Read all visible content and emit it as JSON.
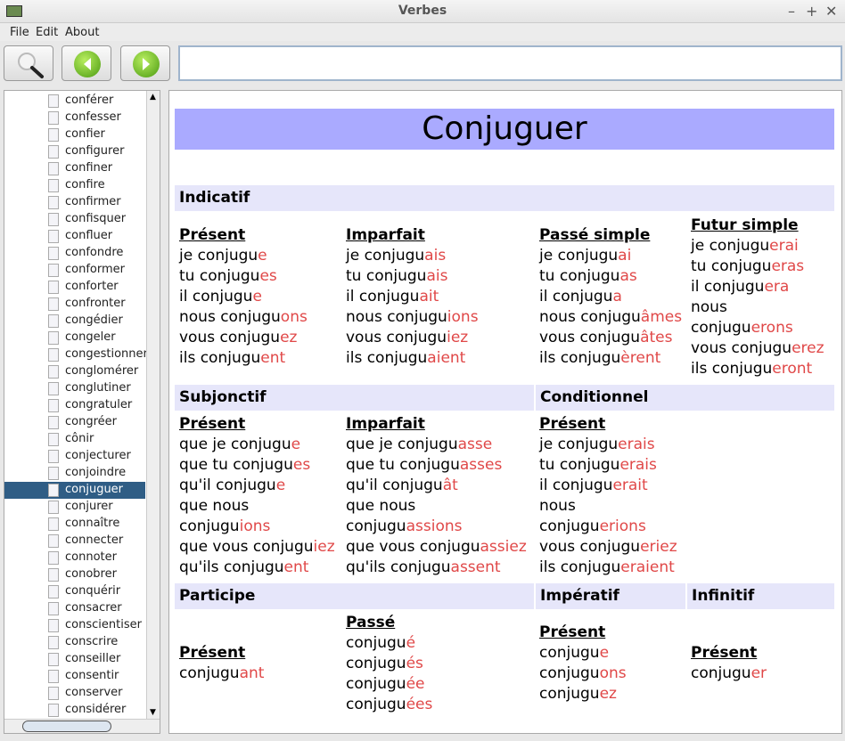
{
  "window": {
    "title": "Verbes"
  },
  "menu": [
    "File",
    "Edit",
    "About"
  ],
  "toolbar": {
    "search_value": ""
  },
  "sidebar": {
    "selected": "conjuguer",
    "items": [
      "conférer",
      "confesser",
      "confier",
      "configurer",
      "confiner",
      "confire",
      "confirmer",
      "confisquer",
      "confluer",
      "confondre",
      "conformer",
      "conforter",
      "confronter",
      "congédier",
      "congeler",
      "congestionner",
      "conglomérer",
      "conglutiner",
      "congratuler",
      "congréer",
      "cônir",
      "conjecturer",
      "conjoindre",
      "conjuguer",
      "conjurer",
      "connaître",
      "connecter",
      "connoter",
      "conobrer",
      "conquérir",
      "consacrer",
      "conscientiser",
      "conscrire",
      "conseiller",
      "consentir",
      "conserver",
      "considérer"
    ]
  },
  "colors": {
    "banner": "#aaaaff",
    "section": "#e6e6fa",
    "ending": "#e04848",
    "selection": "#2f5d85"
  },
  "verb": {
    "title": "Conjuguer",
    "sections": {
      "indicatif": "Indicatif",
      "subjonctif": "Subjonctif",
      "conditionnel": "Conditionnel",
      "participe": "Participe",
      "imperatif": "Impératif",
      "infinitif": "Infinitif"
    },
    "blocks": [
      {
        "id": "ind-present",
        "title": "Présent",
        "forms": [
          [
            "je conjugu",
            "e"
          ],
          [
            "tu conjugu",
            "es"
          ],
          [
            "il conjugu",
            "e"
          ],
          [
            "nous conjugu",
            "ons"
          ],
          [
            "vous conjugu",
            "ez"
          ],
          [
            "ils conjugu",
            "ent"
          ]
        ]
      },
      {
        "id": "ind-imparfait",
        "title": "Imparfait",
        "forms": [
          [
            "je conjugu",
            "ais"
          ],
          [
            "tu conjugu",
            "ais"
          ],
          [
            "il conjugu",
            "ait"
          ],
          [
            "nous conjugu",
            "ions"
          ],
          [
            "vous conjugu",
            "iez"
          ],
          [
            "ils conjugu",
            "aient"
          ]
        ]
      },
      {
        "id": "ind-passe-simple",
        "title": "Passé simple",
        "forms": [
          [
            "je conjugu",
            "ai"
          ],
          [
            "tu conjugu",
            "as"
          ],
          [
            "il conjugu",
            "a"
          ],
          [
            "nous conjugu",
            "âmes"
          ],
          [
            "vous conjugu",
            "âtes"
          ],
          [
            "ils conjugu",
            "èrent"
          ]
        ]
      },
      {
        "id": "ind-futur",
        "title": "Futur simple",
        "forms": [
          [
            "je conjugu",
            "erai"
          ],
          [
            "tu conjugu",
            "eras"
          ],
          [
            "il conjugu",
            "era"
          ],
          [
            "nous conjugu",
            "erons"
          ],
          [
            "vous conjugu",
            "erez"
          ],
          [
            "ils conjugu",
            "eront"
          ]
        ]
      },
      {
        "id": "subj-present",
        "title": "Présent",
        "forms": [
          [
            "que je conjugu",
            "e"
          ],
          [
            "que tu conjugu",
            "es"
          ],
          [
            "qu'il conjugu",
            "e"
          ],
          [
            "que nous conjugu",
            "ions"
          ],
          [
            "que vous conjugu",
            "iez"
          ],
          [
            "qu'ils conjugu",
            "ent"
          ]
        ]
      },
      {
        "id": "subj-imparfait",
        "title": "Imparfait",
        "forms": [
          [
            "que je conjugu",
            "asse"
          ],
          [
            "que tu conjugu",
            "asses"
          ],
          [
            "qu'il conjugu",
            "ât"
          ],
          [
            "que nous conjugu",
            "assions"
          ],
          [
            "que vous conjugu",
            "assiez"
          ],
          [
            "qu'ils conjugu",
            "assent"
          ]
        ]
      },
      {
        "id": "cond-present",
        "title": "Présent",
        "forms": [
          [
            "je conjugu",
            "erais"
          ],
          [
            "tu conjugu",
            "erais"
          ],
          [
            "il conjugu",
            "erait"
          ],
          [
            "nous conjugu",
            "erions"
          ],
          [
            "vous conjugu",
            "eriez"
          ],
          [
            "ils conjugu",
            "eraient"
          ]
        ]
      },
      {
        "id": "part-present",
        "title": "Présent",
        "forms": [
          [
            "conjugu",
            "ant"
          ]
        ]
      },
      {
        "id": "part-passe",
        "title": "Passé",
        "forms": [
          [
            "conjugu",
            "é"
          ],
          [
            "conjugu",
            "és"
          ],
          [
            "conjugu",
            "ée"
          ],
          [
            "conjugu",
            "ées"
          ]
        ]
      },
      {
        "id": "imp-present",
        "title": "Présent",
        "forms": [
          [
            "conjugu",
            "e"
          ],
          [
            "conjugu",
            "ons"
          ],
          [
            "conjugu",
            "ez"
          ]
        ]
      },
      {
        "id": "inf-present",
        "title": "Présent",
        "forms": [
          [
            "conjugu",
            "er"
          ]
        ]
      }
    ]
  }
}
